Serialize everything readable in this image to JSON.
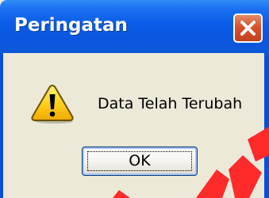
{
  "dialog": {
    "title": "Peringatan",
    "message": "Data Telah Terubah",
    "ok_label": "OK",
    "icon": "warning-icon",
    "close_icon": "close-icon"
  },
  "colors": {
    "titlebar": "#0a5ce8",
    "dialog_bg": "#ece9d8",
    "close_button": "#d6522d",
    "warning_yellow": "#ffd21f",
    "watermark": "#ff2a2a"
  }
}
